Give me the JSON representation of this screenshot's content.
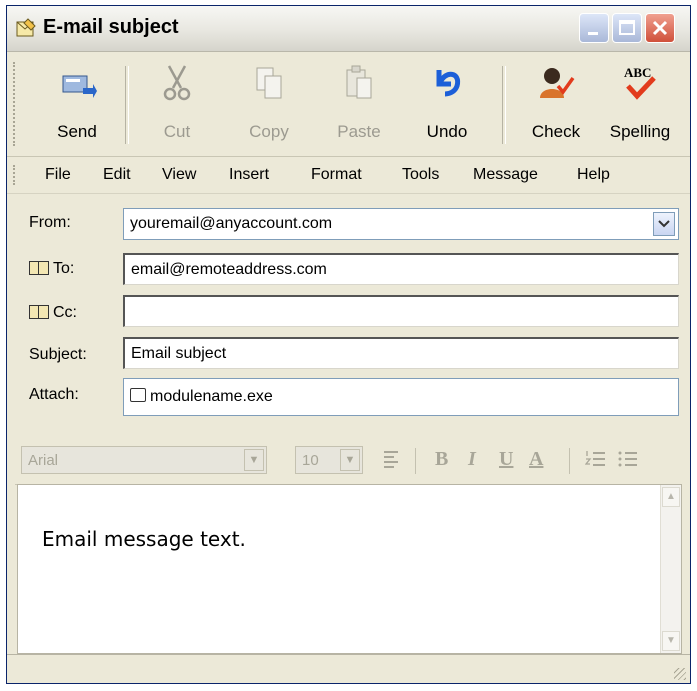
{
  "window": {
    "title": "E-mail subject"
  },
  "toolbar": {
    "send": "Send",
    "cut": "Cut",
    "copy": "Copy",
    "paste": "Paste",
    "undo": "Undo",
    "check": "Check",
    "spelling": "Spelling",
    "spelling_icon_text": "ABC"
  },
  "menu": [
    "File",
    "Edit",
    "View",
    "Insert",
    "Format",
    "Tools",
    "Message",
    "Help"
  ],
  "fields": {
    "from_label": "From:",
    "from_value": "youremail@anyaccount.com",
    "to_label": "To:",
    "to_value": "email@remoteaddress.com",
    "cc_label": "Cc:",
    "cc_value": "",
    "subject_label": "Subject:",
    "subject_value": "Email subject",
    "attach_label": "Attach:",
    "attach_value": "modulename.exe"
  },
  "format": {
    "font": "Arial",
    "size": "10",
    "bold": "B",
    "italic": "I",
    "underline": "U",
    "font_color": "A"
  },
  "body": {
    "text": "Email message text."
  },
  "colors": {
    "undo_blue": "#1c5fd8",
    "check_red": "#e23b1c",
    "window_bg": "#ece9d8"
  }
}
